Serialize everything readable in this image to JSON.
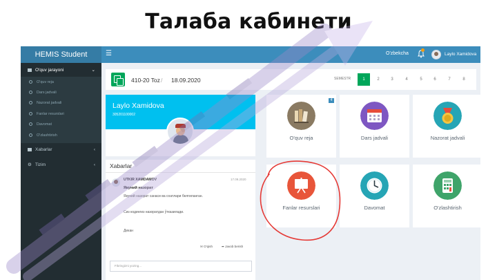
{
  "slide_title": "Талаба кабинети",
  "brand": "HEMIS Student",
  "navbar": {
    "menu_icon": "hamburger-icon",
    "language": "O'zbekcha",
    "user_name": "Laylo Xamidova"
  },
  "sidebar": {
    "section": {
      "label": "O'quv jarayoni",
      "icon": "book-icon"
    },
    "sub_items": [
      {
        "label": "O'quv reja"
      },
      {
        "label": "Dars jadvali"
      },
      {
        "label": "Nazorat jadvali"
      },
      {
        "label": "Fanlar resurslari"
      },
      {
        "label": "Davomat"
      },
      {
        "label": "O'zlashtirish"
      }
    ],
    "items": [
      {
        "label": "Xabarlar",
        "icon": "envelope-icon"
      },
      {
        "label": "Tizim",
        "icon": "gear-icon"
      }
    ]
  },
  "header": {
    "group": "410-20 Toz",
    "separator": "/",
    "date": "18.09.2020",
    "semester_label": "SEMESTR",
    "semesters": [
      "1",
      "2",
      "3",
      "4",
      "5",
      "6",
      "7",
      "8"
    ],
    "active_semester": "1"
  },
  "profile": {
    "name": "Laylo Xamidova",
    "id": "305201100002"
  },
  "news": {
    "title": "Xabarlar",
    "author": "UTKIR XAMDAMOV",
    "date": "17.09.2020",
    "heading": "Якуний назорат",
    "paragraphs": [
      "Якуний назорат санаси ва соатлари белгиланган.",
      "Сиз кодингиз назоратдан ўтказилади.",
      "Декан"
    ],
    "action_read": "O'qish",
    "action_reply": "Javob berish",
    "input_placeholder": "Fikringizni yozing..."
  },
  "tiles": [
    {
      "label": "O'quv reja",
      "icon": "books-icon",
      "color": "#8a7a62",
      "badge": "4"
    },
    {
      "label": "Dars jadvali",
      "icon": "calendar-icon",
      "color": "#7e57c2"
    },
    {
      "label": "Nazorat jadvali",
      "icon": "medal-icon",
      "color": "#26a5b5"
    },
    {
      "label": "Fanlar resurslari",
      "icon": "presentation-board-icon",
      "color": "#e8553a"
    },
    {
      "label": "Davomat",
      "icon": "clock-icon",
      "color": "#26a5b5"
    },
    {
      "label": "O'zlashtirish",
      "icon": "calculator-icon",
      "color": "#3fa46a"
    }
  ],
  "colors": {
    "sidebar": "#222d32",
    "navbar": "#3c8dbc",
    "brand": "#357ca5",
    "accent_green": "#00a65a",
    "profile_banner": "#00c0ef",
    "annotation_red": "#e53935",
    "watermark": "#b39ddb"
  }
}
